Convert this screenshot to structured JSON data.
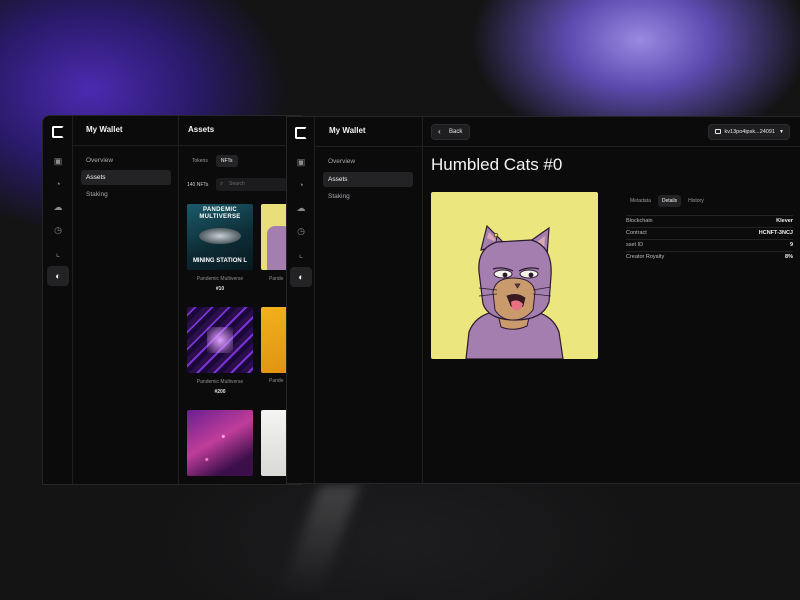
{
  "back_window": {
    "wallet_title": "My Wallet",
    "nav": [
      {
        "label": "Overview",
        "active": false
      },
      {
        "label": "Assets",
        "active": true
      },
      {
        "label": "Staking",
        "active": false
      }
    ],
    "assets": {
      "title": "Assets",
      "tabs": [
        {
          "label": "Tokens",
          "active": false
        },
        {
          "label": "NFTs",
          "active": true
        }
      ],
      "count": "140 NFTs",
      "search_placeholder": "Search",
      "cards": [
        {
          "art": "pandemic-multiverse-mining",
          "art_title": "PANDEMIC MULTIVERSE",
          "art_caption": "MINING STATION L",
          "name": "Pandemic Multiverse",
          "number": "#10"
        },
        {
          "art": "purple-neon-tunnel",
          "name": "Pandemic Multiverse",
          "number": "#200"
        },
        {
          "art": "pink-nebula"
        }
      ],
      "peek_names": [
        "Pande",
        "Pande"
      ]
    }
  },
  "front_window": {
    "wallet_title": "My Wallet",
    "nav": [
      {
        "label": "Overview",
        "active": false
      },
      {
        "label": "Assets",
        "active": true
      },
      {
        "label": "Staking",
        "active": false
      }
    ],
    "back_label": "Back",
    "wallet_address": "kv13po4ipsk...24091",
    "nft": {
      "title": "Humbled Cats #0",
      "image": "humbled-cat-purple-on-yellow",
      "tabs": [
        {
          "label": "Metadata",
          "active": false
        },
        {
          "label": "Details",
          "active": true
        },
        {
          "label": "History",
          "active": false
        }
      ],
      "details": [
        {
          "key": "Blockchain",
          "value": "Klever"
        },
        {
          "key": "Contract",
          "value": "HCNFT-3NCJ"
        },
        {
          "key": "sset ID",
          "value": "9"
        },
        {
          "key": "Creator Royalty",
          "value": "8%"
        }
      ]
    }
  },
  "rail_icons": [
    "clipboard-icon",
    "bell-icon",
    "cloud-icon",
    "clock-icon",
    "chart-icon",
    "theme-icon"
  ],
  "colors": {
    "accent_purple": "#5a3bd0",
    "nft_background": "#ece67f",
    "cat_fur": "#a57eb0"
  }
}
